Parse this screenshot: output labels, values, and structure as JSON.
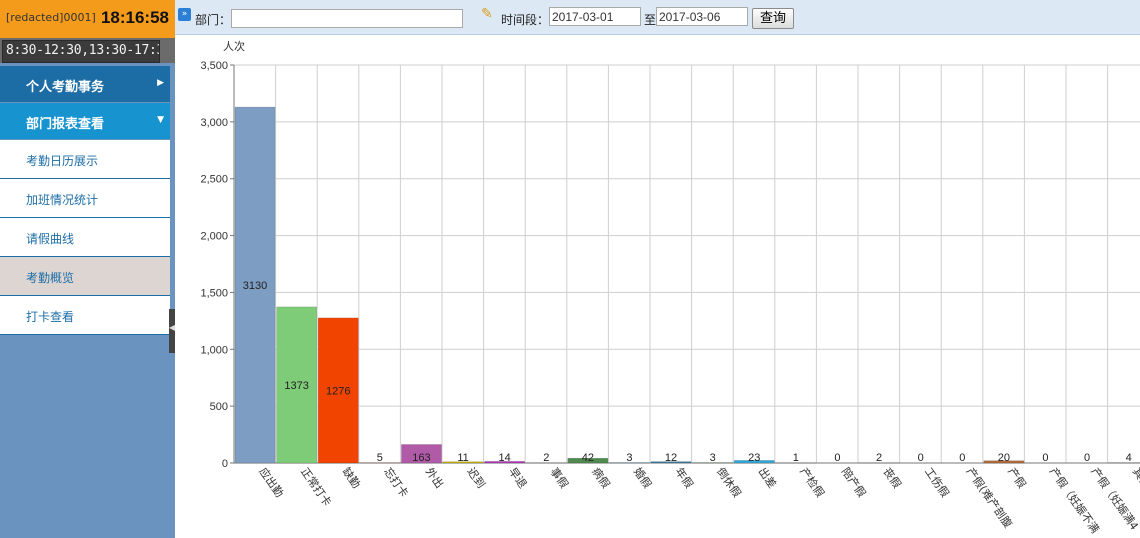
{
  "user": {
    "name": "[redacted]0001]",
    "time": "18:16:58",
    "hours": "8:30-12:30,13:30-17:30"
  },
  "menu": {
    "personal": "个人考勤事务",
    "department": "部门报表查看",
    "items": [
      "考勤日历展示",
      "加班情况统计",
      "请假曲线",
      "考勤概览",
      "打卡查看"
    ],
    "active_item": "考勤概览"
  },
  "filters": {
    "dept_label": "部门：",
    "dept_value": "",
    "period_label": "时间段：",
    "date_from": "2017-03-01",
    "to_label": "至",
    "date_to": "2017-03-06",
    "query_label": "查询"
  },
  "chart_data": {
    "type": "bar",
    "ylabel": "人次",
    "ylim": [
      0,
      3500
    ],
    "yticks": [
      "0",
      "500",
      "1,000",
      "1,500",
      "2,000",
      "2,500",
      "3,000",
      "3,500"
    ],
    "grid": true,
    "categories": [
      "应出勤",
      "正常打卡",
      "缺勤",
      "忘打卡",
      "外出",
      "迟到",
      "早退",
      "事假",
      "病假",
      "婚假",
      "年假",
      "倒休假",
      "出差",
      "产检假",
      "陪产假",
      "丧假",
      "工伤假",
      "产假(难产剖腹",
      "产假",
      "产假（妊娠不满",
      "产假（妊娠满4",
      "其他"
    ],
    "values": [
      3130,
      1373,
      1276,
      5,
      163,
      11,
      14,
      2,
      42,
      3,
      12,
      3,
      23,
      1,
      0,
      2,
      0,
      0,
      20,
      0,
      0,
      4
    ],
    "colors": [
      "#7e9dc3",
      "#7ecb78",
      "#f04400",
      "#cc9999",
      "#b05aa8",
      "#c8b400",
      "#b037b8",
      "#888888",
      "#508a50",
      "#3c7ca6",
      "#3c7ca6",
      "#507c50",
      "#33a8d8",
      "#888888",
      "#888888",
      "#888888",
      "#888888",
      "#888888",
      "#b06a3b",
      "#888888",
      "#888888",
      "#888888"
    ]
  }
}
